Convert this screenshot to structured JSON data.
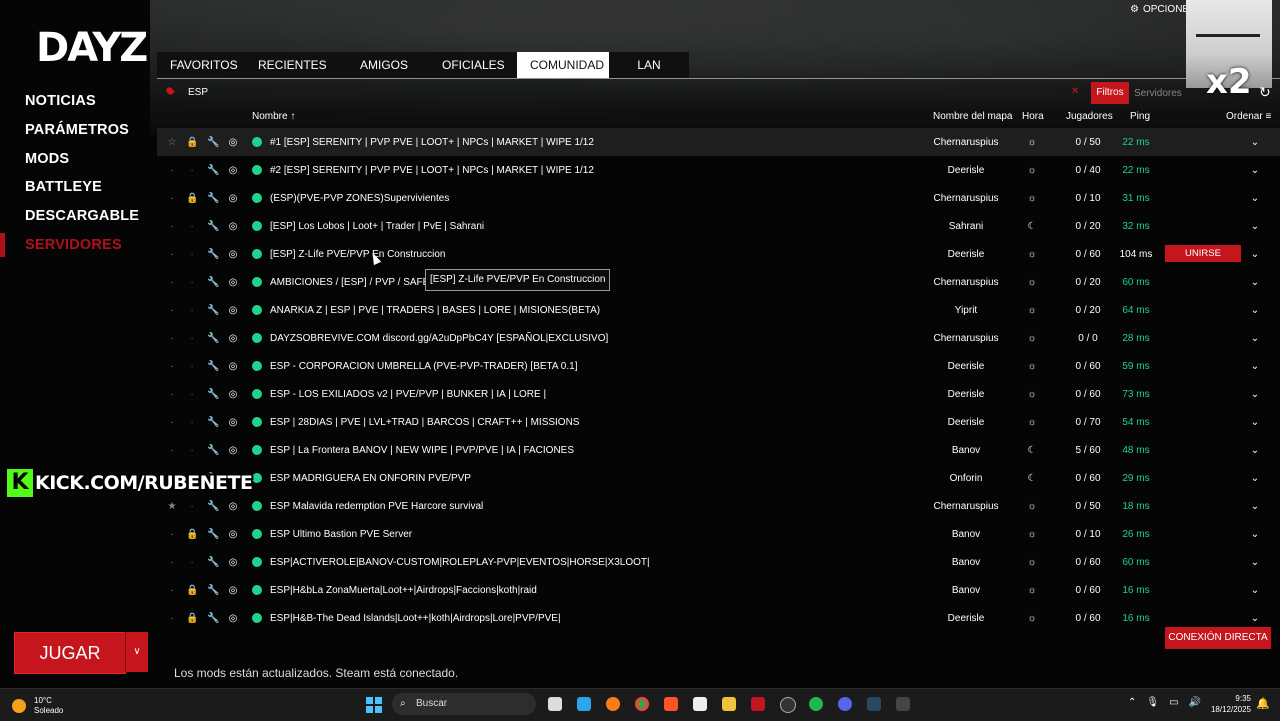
{
  "logo": "DAYZ",
  "menu": [
    "NOTICIAS",
    "PARÁMETROS",
    "MODS",
    "BATTLEYE",
    "DESCARGABLE",
    "SERVIDORES"
  ],
  "tabs": [
    "FAVORITOS",
    "RECIENTES",
    "AMIGOS",
    "OFICIALES",
    "COMUNIDAD",
    "LAN"
  ],
  "active_tab": "COMUNIDAD",
  "options_label": "OPCIONE",
  "search": {
    "value": "ESP",
    "filters_label": "Filtros",
    "servers_label": "Servidores"
  },
  "columns": {
    "name": "Nombre",
    "map": "Nombre del mapa",
    "time": "Hora",
    "players": "Jugadores",
    "ping": "Ping",
    "sort": "Ordenar"
  },
  "servers": [
    {
      "name": "#1 [ESP] SERENITY | PVP PVE | LOOT+ | NPCs | MARKET | WIPE 1/12",
      "map": "Chernaruspius",
      "players": "0 / 50",
      "ping": "22 ms",
      "time": "day",
      "fav": false,
      "lock": false
    },
    {
      "name": "#2 [ESP] SERENITY | PVP PVE | LOOT+ | NPCs | MARKET | WIPE 1/12",
      "map": "Deerisle",
      "players": "0 / 40",
      "ping": "22 ms",
      "time": "day",
      "fav": false,
      "lock": false
    },
    {
      "name": "(ESP)(PVE-PVP ZONES)Supervivientes",
      "map": "Chernaruspius",
      "players": "0 / 10",
      "ping": "31 ms",
      "time": "day",
      "fav": false,
      "lock": true
    },
    {
      "name": "[ESP] Los Lobos  | Loot+ | Trader | PvE | Sahrani",
      "map": "Sahrani",
      "players": "0 / 20",
      "ping": "32 ms",
      "time": "night",
      "fav": false,
      "lock": false
    },
    {
      "name": "[ESP] Z-Life PVE/PVP En Construccion",
      "map": "Deerisle",
      "players": "0 / 60",
      "ping": "104 ms",
      "time": "day",
      "fav": false,
      "lock": false
    },
    {
      "name": "AMBICIONES / [ESP] / PVP / SAFE Z",
      "map": "Chernaruspius",
      "players": "0 / 20",
      "ping": "60 ms",
      "time": "day",
      "fav": false,
      "lock": false
    },
    {
      "name": "ANARKIA Z | ESP | PVE | TRADERS | BASES | LORE | MISIONES(BETA)",
      "map": "Yiprit",
      "players": "0 / 20",
      "ping": "64 ms",
      "time": "day",
      "fav": false,
      "lock": false
    },
    {
      "name": "DAYZSOBREVIVE.COM discord.gg/A2uDpPbC4Y [ESPAÑOL|EXCLUSIVO]",
      "map": "Chernaruspius",
      "players": "0 / 0",
      "ping": "28 ms",
      "time": "day",
      "fav": false,
      "lock": false
    },
    {
      "name": "ESP - CORPORACION UMBRELLA (PVE-PVP-TRADER) [BETA 0.1]",
      "map": "Deerisle",
      "players": "0 / 60",
      "ping": "59 ms",
      "time": "day",
      "fav": false,
      "lock": false
    },
    {
      "name": "ESP - LOS EXILIADOS v2 | PVE/PVP | BUNKER | IA | LORE |",
      "map": "Deerisle",
      "players": "0 / 60",
      "ping": "73 ms",
      "time": "day",
      "fav": false,
      "lock": false
    },
    {
      "name": "ESP | 28DIAS | PVE | LVL+TRAD | BARCOS | CRAFT++ | MISSIONS",
      "map": "Deerisle",
      "players": "0 / 70",
      "ping": "54 ms",
      "time": "day",
      "fav": false,
      "lock": false
    },
    {
      "name": "ESP | La Frontera BANOV | NEW WIPE | PVP/PVE | IA | FACIONES",
      "map": "Banov",
      "players": "5 / 60",
      "ping": "48 ms",
      "time": "night",
      "fav": false,
      "lock": false
    },
    {
      "name": "ESP MADRIGUERA EN ONFORIN PVE/PVP",
      "map": "Onforin",
      "players": "0 / 60",
      "ping": "29 ms",
      "time": "night",
      "fav": false,
      "lock": false
    },
    {
      "name": "ESP Malavida redemption PVE Harcore survival",
      "map": "Chernaruspius",
      "players": "0 / 50",
      "ping": "18 ms",
      "time": "day",
      "fav": true,
      "lock": false
    },
    {
      "name": "ESP Ultimo Bastion PVE Server",
      "map": "Banov",
      "players": "0 / 10",
      "ping": "26 ms",
      "time": "day",
      "fav": false,
      "lock": true
    },
    {
      "name": "ESP|ACTIVEROLE|BANOV-CUSTOM|ROLEPLAY-PVP|EVENTOS|HORSE|X3LOOT|",
      "map": "Banov",
      "players": "0 / 60",
      "ping": "60 ms",
      "time": "day",
      "fav": false,
      "lock": false
    },
    {
      "name": "ESP|H&bLa ZonaMuerta|Loot++|Airdrops|Faccions|koth|raid",
      "map": "Banov",
      "players": "0 / 60",
      "ping": "16 ms",
      "time": "day",
      "fav": false,
      "lock": true
    },
    {
      "name": "ESP|H&B-The Dead Islands|Loot++|koth|Airdrops|Lore|PVP/PVE|",
      "map": "Deerisle",
      "players": "0 / 60",
      "ping": "16 ms",
      "time": "day",
      "fav": false,
      "lock": true
    }
  ],
  "join_label": "UNIRSE",
  "tooltip": "[ESP] Z-Life PVE/PVP En Construccion",
  "kick_overlay": "KICK.COM/RUBENETE",
  "play_button": "JUGAR",
  "status": "Los mods están actualizados. Steam está conectado.",
  "direct_connect": "CONEXIÓN DIRECTA",
  "taskbar": {
    "temp": "10°C",
    "weather": "Soleado",
    "search": "Buscar",
    "time": "9:35",
    "date": "18/12/2025"
  },
  "colors": {
    "accent": "#c4161c",
    "online": "#1fd38a",
    "kick": "#53fc18"
  }
}
